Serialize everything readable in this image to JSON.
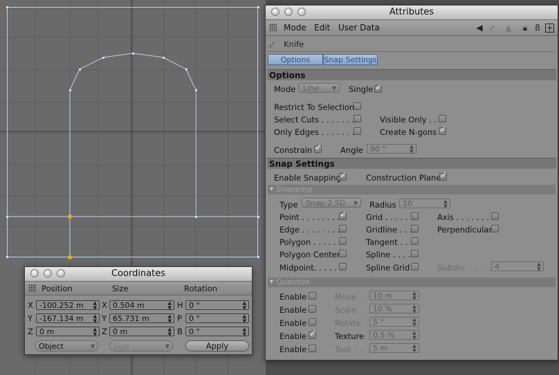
{
  "attributes": {
    "title": "Attributes",
    "menu": {
      "mode": "Mode",
      "edit": "Edit",
      "user_data": "User Data"
    },
    "tool_name": "Knife",
    "tabs": {
      "options": "Options",
      "snap_settings": "Snap Settings"
    },
    "options": {
      "header": "Options",
      "mode_label": "Mode",
      "mode_value": "Line",
      "single_label": "Single",
      "restrict_label": "Restrict To Selection",
      "select_cuts_label": "Select Cuts . . . . . . . .",
      "visible_only_label": "Visible Only . .",
      "only_edges_label": "Only Edges . . . . . . . .",
      "create_ngons_label": "Create N-gons",
      "constrain_label": "Constrain",
      "angle_label": "Angle",
      "angle_value": "90 °"
    },
    "snap": {
      "header": "Snap Settings",
      "enable_snapping_label": "Enable Snapping",
      "construction_plane_label": "Construction Plane",
      "snapping_subheader": "Snapping",
      "type_label": "Type",
      "type_value": "Snap 2.5D",
      "radius_label": "Radius",
      "radius_value": "10",
      "point_label": "Point . . . . . . . .",
      "grid_label": "Grid . . . . . .",
      "axis_label": "Axis . . . . . . . .",
      "edge_label": "Edge . . . . . . . . .",
      "gridline_label": "Gridline . . .",
      "perpendicular_label": "Perpendicular",
      "polygon_label": "Polygon . . . . . .",
      "tangent_label": "Tangent . .",
      "polygon_center_label": "Polygon Center",
      "spline_label": "Spline . . . .",
      "midpoint_label": "Midpoint. . . . .",
      "spline_grid_label": "Spline Grid",
      "subdiv_label": "Subdiv. . . . . .",
      "subdiv_value": "4"
    },
    "quantize": {
      "subheader": "Quantize",
      "enable_label": "Enable",
      "move_label": "Move . .",
      "move_value": "10 m",
      "scale_label": "Scale . .",
      "scale_value": "10 %",
      "rotate_label": "Rotate",
      "rotate_value": "5 °",
      "texture_label": "Texture",
      "texture_value": "0.5 %",
      "tool_label": "Tool. . .",
      "tool_value": "5 m"
    }
  },
  "coordinates": {
    "title": "Coordinates",
    "headers": {
      "position": "Position",
      "size": "Size",
      "rotation": "Rotation"
    },
    "axes": {
      "x": "X",
      "y": "Y",
      "z": "Z",
      "h": "H",
      "p": "P",
      "b": "B"
    },
    "position": {
      "x": "-100.252 m",
      "y": "-167.134 m",
      "z": "0 m"
    },
    "size": {
      "x": "0.504 m",
      "y": "65.731 m",
      "z": "0 m"
    },
    "rotation": {
      "h": "0 °",
      "p": "0 °",
      "b": "0 °"
    },
    "mode_value": "Object",
    "size_dropdown": "Size",
    "apply_label": "Apply"
  },
  "colors": {
    "viewport_bg": "#6a6a6a",
    "selection_outline": "#b8d4ee",
    "active_point": "#f5a623",
    "tab_blue": "#8ca6cc"
  }
}
